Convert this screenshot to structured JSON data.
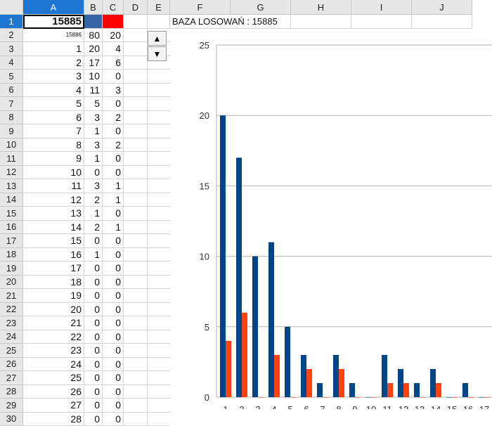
{
  "columns": [
    "A",
    "B",
    "C",
    "D",
    "E",
    "F",
    "G",
    "H",
    "I",
    "J"
  ],
  "selected_column": "A",
  "selected_row": 1,
  "row1": {
    "a1": "15885",
    "b1_color": "#3465a4",
    "c1_color": "#ff0000",
    "f1": "BAZA LOSOWAŃ : 15885"
  },
  "row_numbers": [
    "1",
    "2",
    "3",
    "4",
    "5",
    "6",
    "7",
    "8",
    "9",
    "10",
    "11",
    "12",
    "13",
    "14",
    "15",
    "16",
    "17",
    "18",
    "19",
    "20",
    "21",
    "22",
    "23",
    "24",
    "25",
    "26",
    "27",
    "28",
    "29",
    "30"
  ],
  "table_rows": [
    [
      "15886",
      "80",
      "20"
    ],
    [
      "1",
      "20",
      "4"
    ],
    [
      "2",
      "17",
      "6"
    ],
    [
      "3",
      "10",
      "0"
    ],
    [
      "4",
      "11",
      "3"
    ],
    [
      "5",
      "5",
      "0"
    ],
    [
      "6",
      "3",
      "2"
    ],
    [
      "7",
      "1",
      "0"
    ],
    [
      "8",
      "3",
      "2"
    ],
    [
      "9",
      "1",
      "0"
    ],
    [
      "10",
      "0",
      "0"
    ],
    [
      "11",
      "3",
      "1"
    ],
    [
      "12",
      "2",
      "1"
    ],
    [
      "13",
      "1",
      "0"
    ],
    [
      "14",
      "2",
      "1"
    ],
    [
      "15",
      "0",
      "0"
    ],
    [
      "16",
      "1",
      "0"
    ],
    [
      "17",
      "0",
      "0"
    ],
    [
      "18",
      "0",
      "0"
    ],
    [
      "19",
      "0",
      "0"
    ],
    [
      "20",
      "0",
      "0"
    ],
    [
      "21",
      "0",
      "0"
    ],
    [
      "22",
      "0",
      "0"
    ],
    [
      "23",
      "0",
      "0"
    ],
    [
      "24",
      "0",
      "0"
    ],
    [
      "25",
      "0",
      "0"
    ],
    [
      "26",
      "0",
      "0"
    ],
    [
      "27",
      "0",
      "0"
    ],
    [
      "28",
      "0",
      "0"
    ]
  ],
  "spin_buttons": {
    "up_icon": "▲",
    "down_icon": "▼"
  },
  "chart_data": {
    "type": "bar",
    "categories": [
      "1",
      "2",
      "3",
      "4",
      "5",
      "6",
      "7",
      "8",
      "9",
      "10",
      "11",
      "12",
      "13",
      "14",
      "15",
      "16",
      "17"
    ],
    "series": [
      {
        "color": "#004586",
        "values": [
          20,
          17,
          10,
          11,
          5,
          3,
          1,
          3,
          1,
          0,
          3,
          2,
          1,
          2,
          0,
          1,
          0
        ]
      },
      {
        "color": "#ff420e",
        "values": [
          4,
          6,
          0,
          3,
          0,
          2,
          0,
          2,
          0,
          0,
          1,
          1,
          0,
          1,
          0,
          0,
          0
        ]
      }
    ],
    "y_ticks": [
      "0",
      "5",
      "10",
      "15",
      "20",
      "25"
    ],
    "ylim": [
      0,
      25
    ],
    "grid": true,
    "legend": "none"
  }
}
